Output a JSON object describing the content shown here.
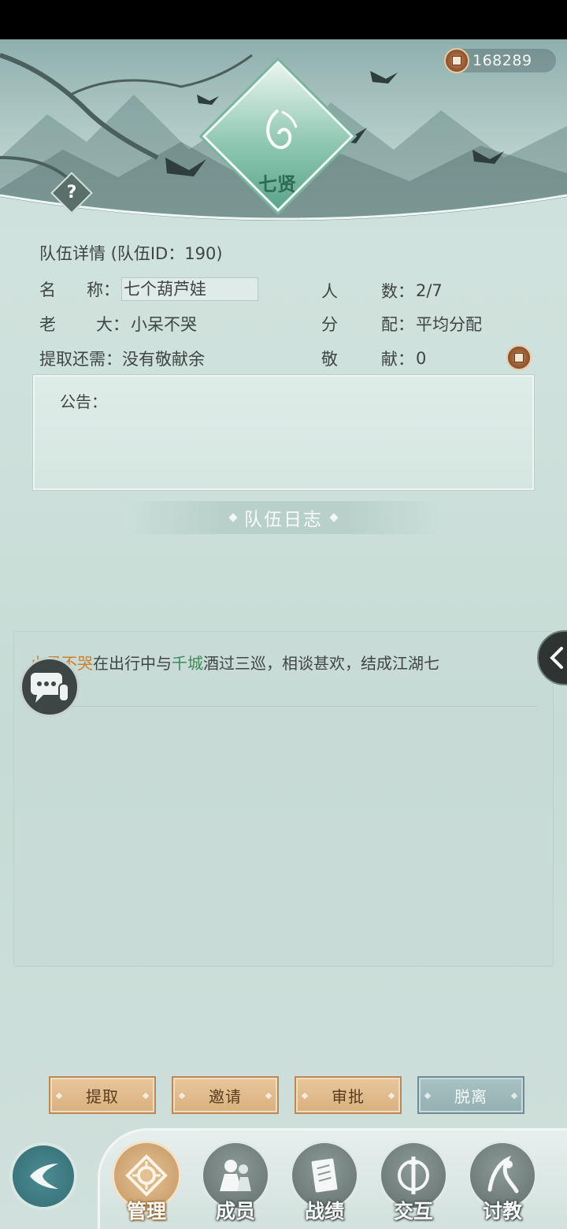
{
  "header": {
    "currency_amount": "168289",
    "team_emblem_name": "七贤",
    "help_glyph": "?"
  },
  "team_info": {
    "title": "队伍详情 (队伍ID：190)",
    "name_label": [
      "名",
      "称："
    ],
    "name_value": "七个葫芦娃",
    "members_label": [
      "人",
      "数："
    ],
    "members_value": "2/7",
    "leader_label": [
      "老",
      "大："
    ],
    "leader_value": "小呆不哭",
    "distribution_label": [
      "分",
      "配："
    ],
    "distribution_value": "平均分配",
    "withdraw_label": "提取还需：",
    "withdraw_value": "没有敬献余",
    "contribution_label": [
      "敬",
      "献："
    ],
    "contribution_value": "0"
  },
  "notice": {
    "label": "公告："
  },
  "log": {
    "title": "队伍日志",
    "entry": {
      "player": "小呆不哭",
      "text1": "在出行中与",
      "partner": "千城",
      "text2": "酒过三巡，相谈甚欢，结成江湖七"
    }
  },
  "actions": {
    "withdraw": "提取",
    "invite": "邀请",
    "approve": "审批",
    "leave": "脱离"
  },
  "nav": {
    "items": [
      {
        "label": "管理",
        "icon": "manage-icon",
        "active": true
      },
      {
        "label": "成员",
        "icon": "members-icon"
      },
      {
        "label": "战绩",
        "icon": "record-icon"
      },
      {
        "label": "交互",
        "icon": "interact-icon"
      },
      {
        "label": "讨教",
        "icon": "duel-icon"
      }
    ]
  },
  "colors": {
    "accent_gold": "#d9b07f",
    "accent_teal": "#93b0b2",
    "highlight_orange": "#c9822f",
    "highlight_green": "#3f8a5a"
  }
}
